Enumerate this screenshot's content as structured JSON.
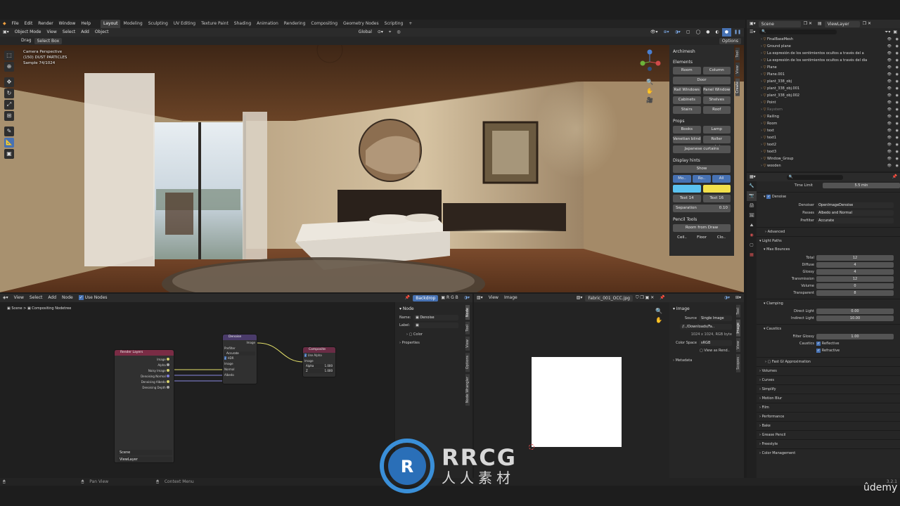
{
  "menu": [
    "File",
    "Edit",
    "Render",
    "Window",
    "Help"
  ],
  "workspaces": [
    "Layout",
    "Modeling",
    "Sculpting",
    "UV Editing",
    "Texture Paint",
    "Shading",
    "Animation",
    "Rendering",
    "Compositing",
    "Geometry Nodes",
    "Scripting"
  ],
  "scene_name": "Scene",
  "view_layer": "ViewLayer",
  "viewport": {
    "mode": "Object Mode",
    "menus": [
      "View",
      "Select",
      "Add",
      "Object"
    ],
    "transform": "Global",
    "drag_label": "Drag",
    "drag_value": "Select Box",
    "options_label": "Options",
    "overlay_camera": "Camera Perspective",
    "overlay_collection": "(150) DUST PARTICLES",
    "overlay_sample": "Sample 74/1024"
  },
  "archimesh": {
    "title": "Archimesh",
    "elements_title": "Elements",
    "elements": [
      "Room",
      "Column",
      "Door",
      "Rail Windows",
      "Panel Window",
      "Cabinets",
      "Shelves",
      "Stairs",
      "Roof"
    ],
    "props_title": "Props",
    "props": [
      "Books",
      "Lamp",
      "Venetian blind",
      "Roller curtains",
      "Japanese curtains"
    ],
    "display_title": "Display hints",
    "show_label": "Show",
    "hint_buttons": [
      "Mo..",
      "Ro..",
      "All"
    ],
    "text_a": "Text  14",
    "text_b": "Text  16",
    "separation_label": "Separation",
    "separation_value": "0.10",
    "pencil_title": "Pencil Tools",
    "room_from_draw": "Room from Draw",
    "pencil_opts": [
      "Ceil..",
      "Floor",
      "Clo.."
    ]
  },
  "n_tabs": [
    "Tool",
    "View",
    "Create"
  ],
  "node_editor": {
    "menus": [
      "View",
      "Select",
      "Add",
      "Node"
    ],
    "use_nodes": "Use Nodes",
    "backdrop": "Backdrop",
    "breadcrumb_scene": "Scene",
    "breadcrumb_tree": "Compositing Nodetree",
    "render_layers": {
      "title": "Render Layers",
      "outputs": [
        "Image",
        "Alpha",
        "Noisy Image",
        "Denoising Normal",
        "Denoising Albedo",
        "Denoising Depth"
      ],
      "scene": "Scene",
      "layer": "ViewLayer"
    },
    "denoise": {
      "title": "Denoise",
      "output": "Image",
      "prefilter_label": "Prefilter",
      "prefilter_value": "Accurate",
      "hdr": "HDR",
      "inputs": [
        "Image",
        "Normal",
        "Albedo"
      ]
    },
    "composite": {
      "title": "Composite",
      "use_alpha": "Use Alpha",
      "input": "Image",
      "alpha_label": "Alpha",
      "alpha_value": "1.000",
      "z_label": "Z",
      "z_value": "1.000"
    }
  },
  "node_sidebar": {
    "section": "Node",
    "name_label": "Name:",
    "name_value": "Denoise",
    "label_label": "Label:",
    "color_label": "Color",
    "properties_label": "Properties",
    "tabs": [
      "Node",
      "Tool",
      "View",
      "Options",
      "Node Wrangler"
    ]
  },
  "image_editor": {
    "menus": [
      "View",
      "Image"
    ],
    "image_name": "Fabric_001_OCC.jpg",
    "panel_title": "Image",
    "source_label": "Source",
    "source_value": "Single Image",
    "path_value": "//../Downloads/Fa..",
    "info": "1024 x 1024,  RGB byte",
    "color_space_label": "Color Space",
    "color_space_value": "sRGB",
    "view_as_render": "View as Rend..",
    "metadata_label": "Metadata",
    "tabs": [
      "Tool",
      "Image",
      "View",
      "Scopes"
    ]
  },
  "outliner": {
    "search_placeholder": "",
    "items": [
      {
        "name": "FinalBaseMesh",
        "dim": false
      },
      {
        "name": "Ground plane",
        "dim": false
      },
      {
        "name": "La expresión de los sentimientos ocultos a través del a",
        "dim": false
      },
      {
        "name": "La expresión de los sentimientos ocultos a través del dia",
        "dim": false
      },
      {
        "name": "Plane",
        "dim": false
      },
      {
        "name": "Plane.001",
        "dim": false
      },
      {
        "name": "plant_338_obj",
        "dim": false
      },
      {
        "name": "plant_338_obj.001",
        "dim": false
      },
      {
        "name": "plant_338_obj.002",
        "dim": false
      },
      {
        "name": "Point",
        "dim": false
      },
      {
        "name": "Raystem",
        "dim": true
      },
      {
        "name": "Railing",
        "dim": false
      },
      {
        "name": "Room",
        "dim": false
      },
      {
        "name": "text",
        "dim": false
      },
      {
        "name": "text1",
        "dim": false
      },
      {
        "name": "text2",
        "dim": false
      },
      {
        "name": "text3",
        "dim": false
      },
      {
        "name": "Window_Group",
        "dim": false
      },
      {
        "name": "wooden",
        "dim": false
      }
    ]
  },
  "properties": {
    "time_limit_label": "Time Limit",
    "time_limit_value": "5.5 min",
    "denoise_label": "Denoise",
    "denoiser_label": "Denoiser",
    "denoiser_value": "OpenImageDenoise",
    "passes_label": "Passes",
    "passes_value": "Albedo and Normal",
    "prefilter_label": "Prefilter",
    "prefilter_value": "Accurate",
    "advanced_label": "Advanced",
    "light_paths_label": "Light Paths",
    "max_bounces_label": "Max Bounces",
    "bounces": [
      {
        "label": "Total",
        "value": "12"
      },
      {
        "label": "Diffuse",
        "value": "4"
      },
      {
        "label": "Glossy",
        "value": "4"
      },
      {
        "label": "Transmission",
        "value": "12"
      },
      {
        "label": "Volume",
        "value": "0"
      },
      {
        "label": "Transparent",
        "value": "8"
      }
    ],
    "clamping_label": "Clamping",
    "direct_light_label": "Direct Light",
    "direct_light_value": "0.00",
    "indirect_light_label": "Indirect Light",
    "indirect_light_value": "10.00",
    "caustics_label": "Caustics",
    "filter_glossy_label": "Filter Glossy",
    "filter_glossy_value": "1.00",
    "caustics_row_label": "Caustics",
    "reflective": "Reflective",
    "refractive": "Refractive",
    "fast_gi": "Fast GI Approximation",
    "sections": [
      "Volumes",
      "Curves",
      "Simplify",
      "Motion Blur",
      "Film",
      "Performance",
      "Bake",
      "Grease Pencil",
      "Freestyle",
      "Color Management"
    ]
  },
  "status": {
    "pan_view": "Pan View",
    "context_menu": "Context Menu",
    "version": "3.2.1"
  },
  "watermark": {
    "rrcg": "RRCG",
    "chinese": "人人素材",
    "udemy": "ûdemy"
  }
}
